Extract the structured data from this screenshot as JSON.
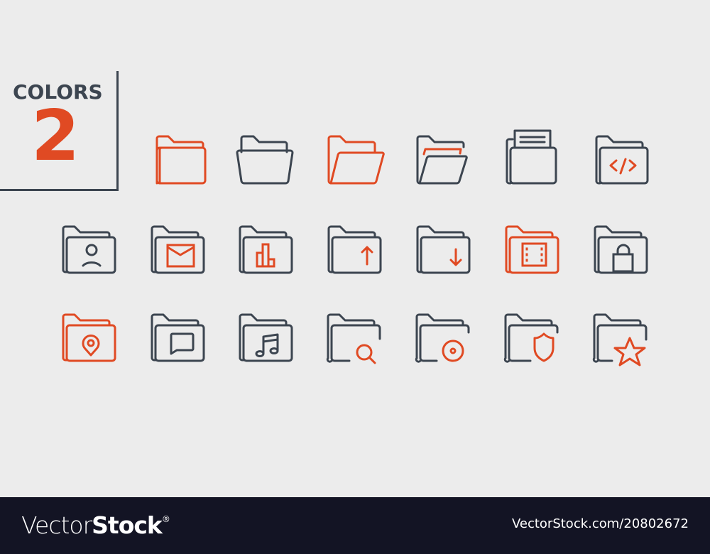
{
  "badge": {
    "label": "COLORS",
    "number": "2"
  },
  "colors": {
    "primary": "#3c4550",
    "accent": "#e04a23",
    "background": "#ececec",
    "footer": "#131424"
  },
  "icons": [
    {
      "name": "folder",
      "row": 1,
      "col": 1,
      "color": "accent"
    },
    {
      "name": "folder-open-box",
      "row": 1,
      "col": 2,
      "color": "primary"
    },
    {
      "name": "folder-open",
      "row": 1,
      "col": 3,
      "color": "accent"
    },
    {
      "name": "folder-open-files",
      "row": 1,
      "col": 4,
      "color": "primary+accent"
    },
    {
      "name": "folder-document",
      "row": 1,
      "col": 5,
      "color": "primary"
    },
    {
      "name": "folder-code",
      "row": 1,
      "col": 6,
      "color": "primary+accent"
    },
    {
      "name": "folder-user",
      "row": 2,
      "col": 1,
      "color": "primary"
    },
    {
      "name": "folder-mail",
      "row": 2,
      "col": 2,
      "color": "primary+accent"
    },
    {
      "name": "folder-chart",
      "row": 2,
      "col": 3,
      "color": "primary+accent"
    },
    {
      "name": "folder-upload",
      "row": 2,
      "col": 4,
      "color": "primary+accent"
    },
    {
      "name": "folder-download",
      "row": 2,
      "col": 5,
      "color": "primary+accent"
    },
    {
      "name": "folder-video",
      "row": 2,
      "col": 6,
      "color": "accent"
    },
    {
      "name": "folder-lock",
      "row": 2,
      "col": 7,
      "color": "primary"
    },
    {
      "name": "folder-location",
      "row": 3,
      "col": 1,
      "color": "accent"
    },
    {
      "name": "folder-chat",
      "row": 3,
      "col": 2,
      "color": "primary"
    },
    {
      "name": "folder-music",
      "row": 3,
      "col": 3,
      "color": "primary"
    },
    {
      "name": "folder-search",
      "row": 3,
      "col": 4,
      "color": "primary+accent"
    },
    {
      "name": "folder-disc",
      "row": 3,
      "col": 5,
      "color": "primary+accent"
    },
    {
      "name": "folder-shield",
      "row": 3,
      "col": 6,
      "color": "primary+accent"
    },
    {
      "name": "folder-star",
      "row": 3,
      "col": 7,
      "color": "primary+accent"
    }
  ],
  "footer": {
    "logo_thin": "Vector",
    "logo_bold": "Stock",
    "logo_mark": "®",
    "url": "VectorStock.com/20802672"
  }
}
